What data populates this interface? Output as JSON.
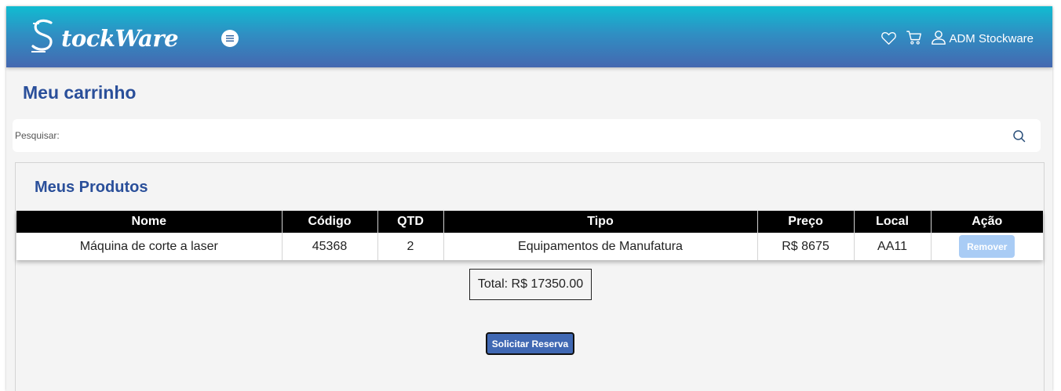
{
  "header": {
    "brand_letter": "S",
    "brand_text": "tockWare",
    "user_name": "ADM Stockware",
    "icons": [
      "hamburger-icon",
      "heart-icon",
      "cart-icon",
      "user-icon"
    ]
  },
  "page": {
    "title": "Meu carrinho"
  },
  "search": {
    "label": "Pesquisar:",
    "value": "",
    "placeholder": ""
  },
  "products": {
    "title": "Meus Produtos",
    "columns": [
      "Nome",
      "Código",
      "QTD",
      "Tipo",
      "Preço",
      "Local",
      "Ação"
    ],
    "rows": [
      {
        "name": "Máquina de corte a laser",
        "code": "45368",
        "qty": "2",
        "type": "Equipamentos de Manufatura",
        "price": "R$ 8675",
        "location": "AA11",
        "action_label": "Remover"
      }
    ]
  },
  "total": {
    "label": "Total: R$ 17350.00"
  },
  "actions": {
    "reserve_label": "Solicitar Reserva"
  },
  "colors": {
    "header_top": "#10bcd1",
    "header_bottom": "#4568b0",
    "title": "#2a4f9a",
    "remove_button": "#a9ccf5",
    "reserve_button": "#4068b3"
  }
}
